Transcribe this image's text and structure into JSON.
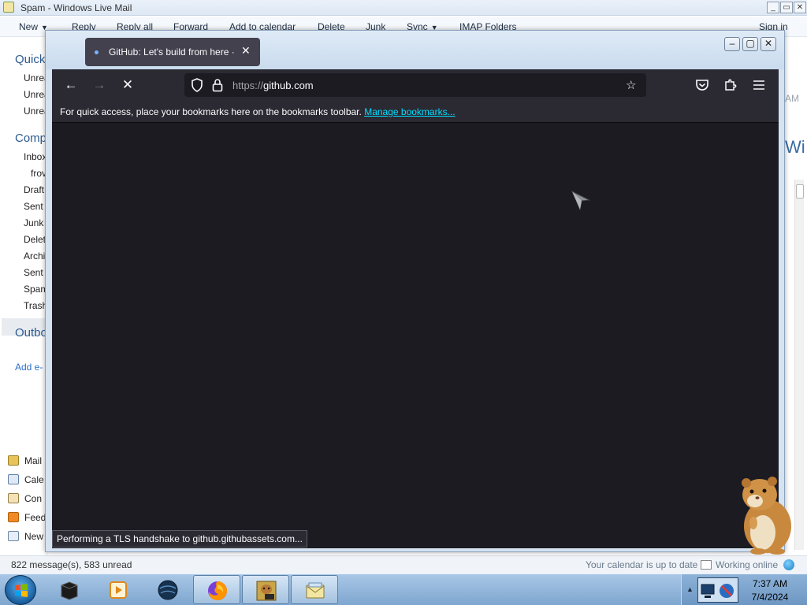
{
  "mail": {
    "title": "Spam - Windows Live Mail",
    "toolbar": {
      "new": "New",
      "reply": "Reply",
      "reply_all": "Reply all",
      "forward": "Forward",
      "add_to_calendar": "Add to calendar",
      "delete": "Delete",
      "junk": "Junk",
      "sync": "Sync",
      "imap_folders": "IMAP Folders",
      "sign_in": "Sign in"
    },
    "left_pane": {
      "quick_views": "Quick",
      "quick_items": [
        "Unrea",
        "Unrea",
        "Unrea"
      ],
      "account": "Comp",
      "folders": [
        "Inbox",
        "frov",
        "Draft",
        "Sent I",
        "Junk",
        "Delet",
        "Archi",
        "Sent",
        "Spam",
        "Trash"
      ],
      "outbox": "Outbo",
      "add_account": "Add e-",
      "nav": [
        "Mail",
        "Cale",
        "Con",
        "Feed",
        "New"
      ]
    },
    "right_pane": {
      "time_fragment": "AM",
      "heading_fragment": "Wi"
    },
    "status": {
      "messages": "822 message(s), 583 unread",
      "calendar": "Your calendar is up to date",
      "online": "Working online"
    }
  },
  "browser": {
    "tab_title": "GitHub: Let's build from here · G",
    "url_scheme": "https://",
    "url_host": "github.com",
    "bookmarks_hint": "For quick access, place your bookmarks here on the bookmarks toolbar.",
    "manage_bookmarks": "Manage bookmarks...",
    "status_text": "Performing a TLS handshake to github.githubassets.com..."
  },
  "taskbar": {
    "time": "7:37 AM",
    "date": "7/4/2024"
  },
  "colors": {
    "firefox_chrome": "#2b2a33",
    "firefox_page": "#1c1b22",
    "link": "#00ddff",
    "mail_heading": "#2c5a8f"
  }
}
